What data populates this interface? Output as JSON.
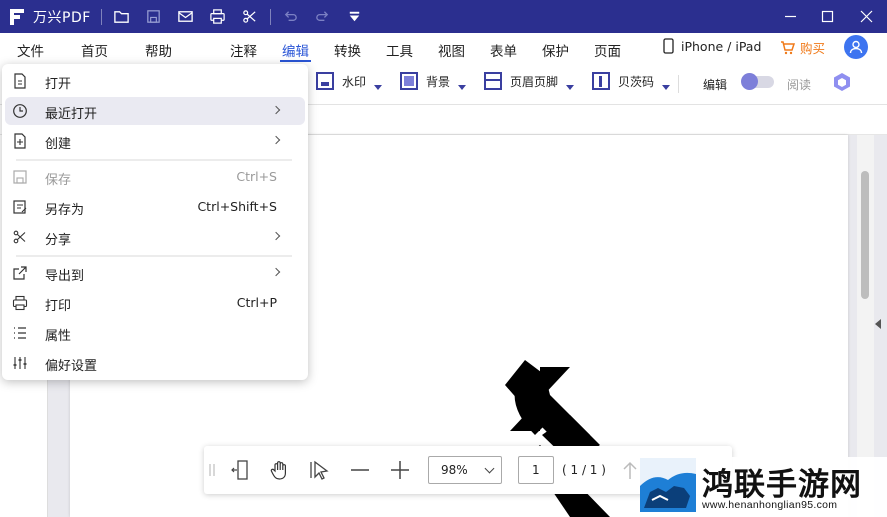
{
  "titlebar": {
    "app_title": "万兴PDF",
    "bg_color": "#2b2f8f",
    "icons": [
      "folder-icon",
      "save-icon",
      "mail-icon",
      "print-icon",
      "share-icon",
      "undo-icon",
      "redo-icon",
      "quick-access-dropdown-icon"
    ]
  },
  "menubar": {
    "items": [
      "文件",
      "首页",
      "帮助",
      "注释",
      "编辑",
      "转换",
      "工具",
      "视图",
      "表单",
      "保护",
      "页面"
    ],
    "active": "编辑",
    "device_label": "iPhone / iPad",
    "buy_label": "购买",
    "accent_color": "#2b56d6",
    "buy_color": "#f07a1a"
  },
  "toolbar": {
    "watermark": "水印",
    "background": "背景",
    "header_footer": "页眉页脚",
    "bates": "贝茨码",
    "edit_label": "编辑",
    "read_label": "阅读"
  },
  "file_menu": {
    "items": [
      {
        "icon": "open-file-icon",
        "label": "打开",
        "shortcut": "",
        "submenu": false,
        "disabled": false
      },
      {
        "icon": "recent-clock-icon",
        "label": "最近打开",
        "shortcut": "",
        "submenu": true,
        "disabled": false
      },
      {
        "icon": "create-file-icon",
        "label": "创建",
        "shortcut": "",
        "submenu": true,
        "disabled": false
      },
      {
        "icon": "save-icon",
        "label": "保存",
        "shortcut": "Ctrl+S",
        "submenu": false,
        "disabled": true
      },
      {
        "icon": "save-as-icon",
        "label": "另存为",
        "shortcut": "Ctrl+Shift+S",
        "submenu": false,
        "disabled": false
      },
      {
        "icon": "share-icon",
        "label": "分享",
        "shortcut": "",
        "submenu": true,
        "disabled": false
      },
      {
        "icon": "export-icon",
        "label": "导出到",
        "shortcut": "",
        "submenu": true,
        "disabled": false
      },
      {
        "icon": "print-icon",
        "label": "打印",
        "shortcut": "Ctrl+P",
        "submenu": false,
        "disabled": false
      },
      {
        "icon": "properties-icon",
        "label": "属性",
        "shortcut": "",
        "submenu": false,
        "disabled": false
      },
      {
        "icon": "preferences-icon",
        "label": "偏好设置",
        "shortcut": "",
        "submenu": false,
        "disabled": false
      }
    ],
    "hovered": "最近打开"
  },
  "bottombar": {
    "zoom": "98%",
    "page_input": "1",
    "page_total": "( 1 / 1 )"
  },
  "watermark_logo": {
    "title": "鸿联手游网",
    "url": "www.henanhonglian95.com"
  }
}
